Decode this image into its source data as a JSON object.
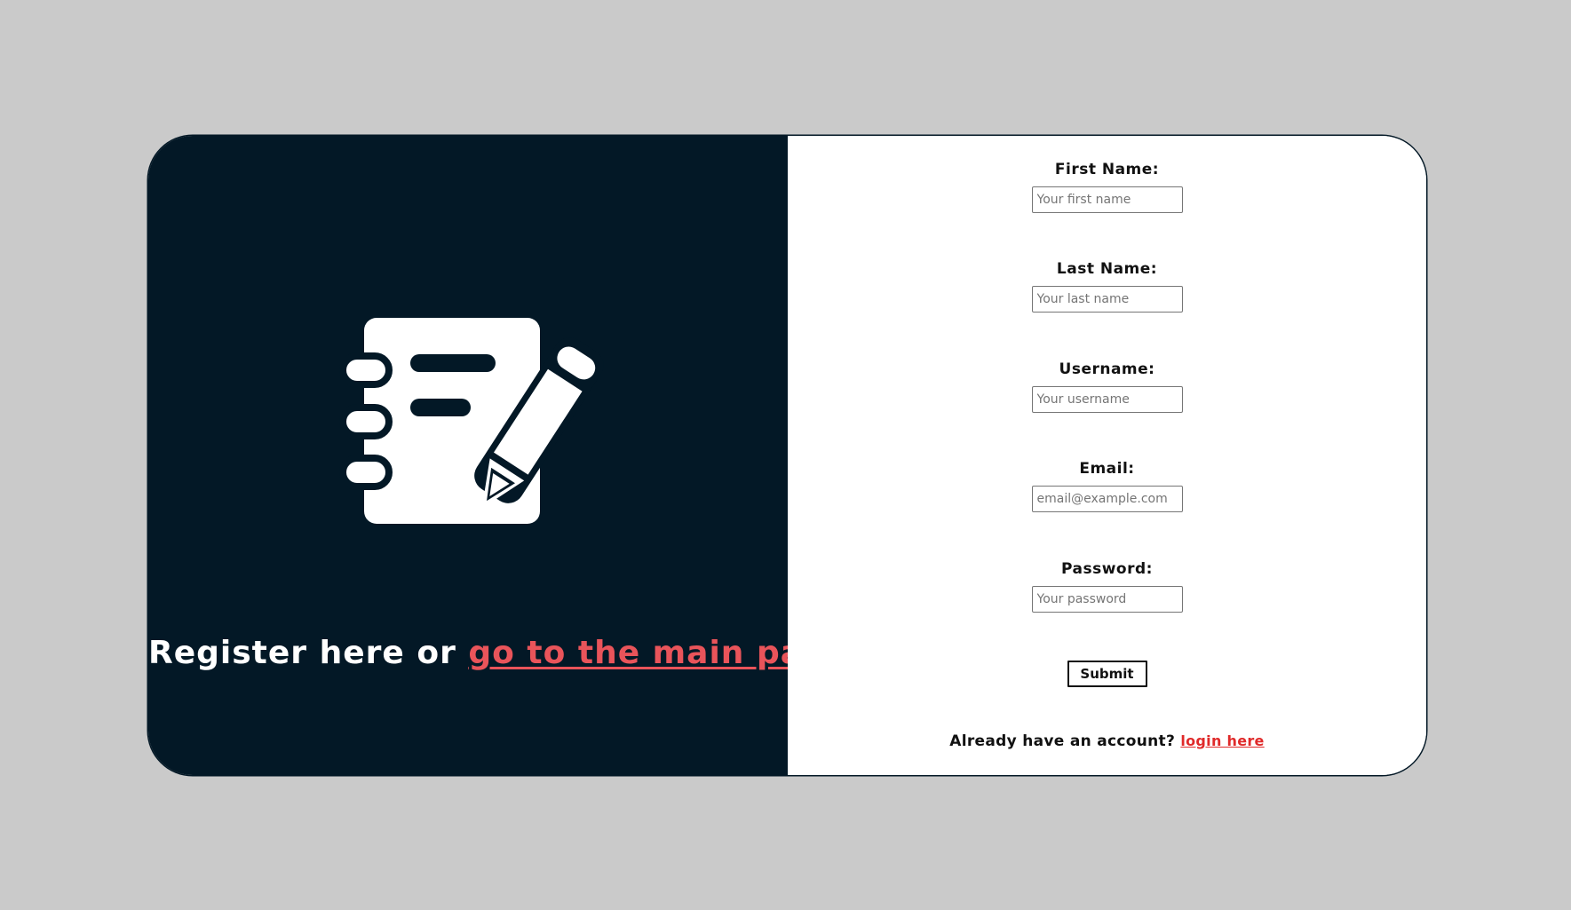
{
  "colors": {
    "background": "#cacaca",
    "left_panel": "#031826",
    "accent_link": "#e9545a",
    "login_link": "#e02a2a"
  },
  "hero": {
    "icon": "notebook-pencil-icon",
    "caption_prefix": "Register here or ",
    "caption_link": "go to the main page"
  },
  "form": {
    "first_name": {
      "label": "First Name:",
      "placeholder": "Your first name",
      "value": ""
    },
    "last_name": {
      "label": "Last Name:",
      "placeholder": "Your last name",
      "value": ""
    },
    "username": {
      "label": "Username:",
      "placeholder": "Your username",
      "value": ""
    },
    "email": {
      "label": "Email:",
      "placeholder": "email@example.com",
      "value": ""
    },
    "password": {
      "label": "Password:",
      "placeholder": "Your password",
      "value": ""
    },
    "submit_label": "Submit"
  },
  "footer": {
    "prompt": "Already have an account? ",
    "login_link": "login here"
  }
}
